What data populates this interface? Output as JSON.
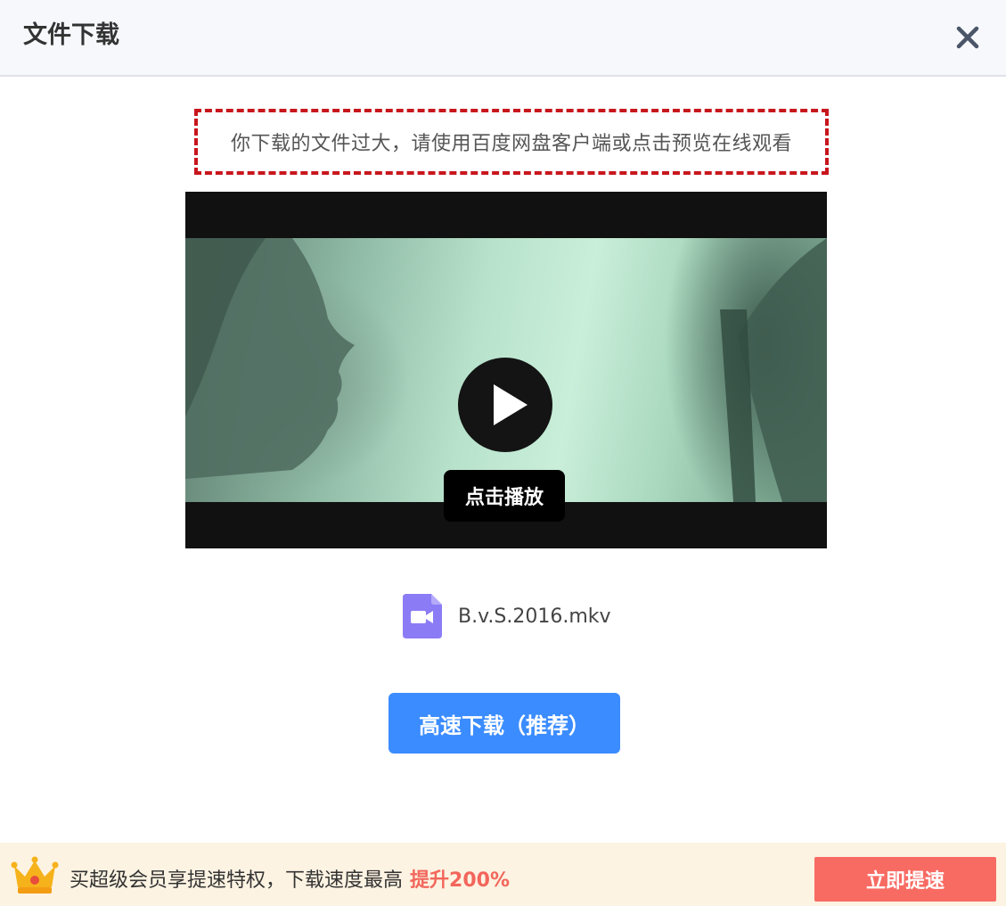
{
  "header": {
    "title": "文件下载",
    "close_icon": "close-icon"
  },
  "notice": {
    "text": "你下载的文件过大，请使用百度网盘客户端或点击预览在线观看",
    "border_color": "#c8161d"
  },
  "video": {
    "play_label": "点击播放",
    "play_icon": "play-icon"
  },
  "file": {
    "icon": "video-file-icon",
    "name": "B.v.S.2016.mkv"
  },
  "download_button": {
    "label": "高速下载（推荐）",
    "color": "#3b8cff"
  },
  "footer": {
    "crown_icon": "crown-icon",
    "promo_text": "买超级会员享提速特权，下载速度最高",
    "promo_highlight": "提升200%",
    "speedup_label": "立即提速",
    "accent_color": "#f86b63"
  }
}
